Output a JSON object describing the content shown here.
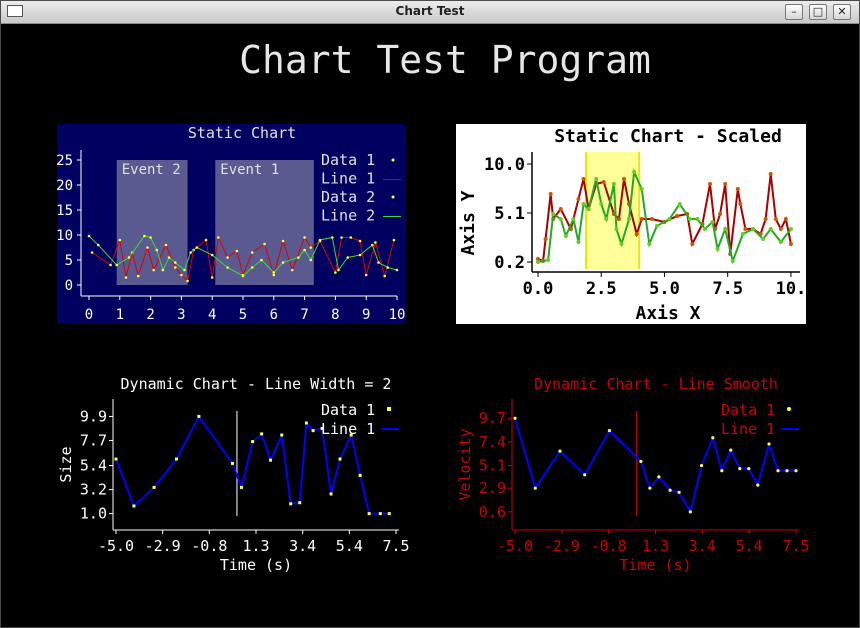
{
  "window": {
    "title": "Chart Test"
  },
  "app_title": "Chart Test Program",
  "chart_data": [
    {
      "type": "line",
      "title": "Static Chart",
      "xlim": [
        0,
        10
      ],
      "ylim": [
        0,
        27
      ],
      "x_ticks": [
        "0",
        "1",
        "2",
        "3",
        "4",
        "5",
        "6",
        "7",
        "8",
        "9",
        "10"
      ],
      "y_ticks": [
        "0",
        "5",
        "10",
        "15",
        "20",
        "25"
      ],
      "legend_position": "top-right",
      "events": [
        {
          "name": "Event 2",
          "x_start": 0.9,
          "x_end": 3.2
        },
        {
          "name": "Event 1",
          "x_start": 4.1,
          "x_end": 7.3
        }
      ],
      "series": [
        {
          "name": "Data 1",
          "color": "#ffff44",
          "x": [
            0.1,
            0.7,
            1.0,
            1.2,
            1.4,
            1.6,
            1.9,
            2.1,
            2.5,
            2.8,
            3.0,
            3.2,
            3.4,
            3.8,
            4.0,
            4.2,
            4.5,
            4.8,
            5.0,
            5.3,
            5.7,
            6.0,
            6.3,
            6.6,
            7.0,
            7.2,
            7.5,
            8.0,
            8.2,
            8.5,
            8.8,
            9.0,
            9.3,
            9.6,
            9.9
          ],
          "y": [
            6.5,
            4.0,
            9.0,
            1.5,
            6.5,
            1.8,
            7.5,
            3.0,
            8.0,
            3.5,
            2.0,
            0.8,
            7.0,
            9.0,
            1.5,
            9.5,
            5.5,
            6.8,
            2.0,
            6.5,
            8.2,
            2.0,
            8.8,
            3.0,
            9.5,
            7.5,
            8.8,
            2.5,
            9.5,
            9.5,
            8.8,
            2.0,
            8.5,
            1.8,
            9.0
          ]
        },
        {
          "name": "Data 2",
          "color": "#ffff44",
          "x": [
            0.0,
            0.3,
            0.9,
            1.3,
            1.8,
            2.0,
            2.2,
            2.4,
            2.6,
            2.8,
            3.1,
            3.3,
            3.5,
            4.0,
            4.5,
            5.0,
            5.3,
            5.6,
            6.0,
            6.3,
            6.8,
            7.0,
            7.2,
            7.5,
            7.9,
            8.1,
            8.4,
            8.8,
            9.2,
            9.4,
            9.7,
            10.0
          ],
          "y": [
            9.8,
            8.0,
            4.0,
            5.5,
            9.8,
            9.5,
            7.0,
            3.0,
            5.5,
            4.5,
            3.0,
            6.5,
            7.5,
            6.0,
            3.5,
            1.8,
            3.5,
            5.0,
            2.5,
            4.5,
            5.5,
            7.0,
            5.0,
            9.0,
            9.5,
            3.0,
            5.5,
            6.0,
            8.0,
            4.5,
            3.5,
            3.0
          ]
        }
      ]
    },
    {
      "type": "line",
      "title": "Static Chart - Scaled",
      "xlabel": "Axis X",
      "ylabel": "Axis Y",
      "xlim": [
        0,
        10.2
      ],
      "ylim": [
        -0.5,
        11.2
      ],
      "x_ticks": [
        {
          "value": 0.0,
          "label": "0.0"
        },
        {
          "value": 2.5,
          "label": "2.5"
        },
        {
          "value": 5.0,
          "label": "5.0"
        },
        {
          "value": 7.5,
          "label": "7.5"
        },
        {
          "value": 10.0,
          "label": "10."
        }
      ],
      "y_ticks": [
        {
          "value": 10.0,
          "label": "10.0"
        },
        {
          "value": 5.1,
          "label": "5.1"
        },
        {
          "value": 0.2,
          "label": "0.2"
        }
      ],
      "highlight": {
        "x_start": 1.9,
        "x_end": 4.0,
        "color": "#ffff99"
      },
      "series": [
        {
          "name": "red",
          "color": "#aa0000",
          "x": [
            0.0,
            0.2,
            0.3,
            0.5,
            0.6,
            0.9,
            1.3,
            1.6,
            1.8,
            2.0,
            2.3,
            2.6,
            3.0,
            3.2,
            3.4,
            3.6,
            3.9,
            4.1,
            4.5,
            5.0,
            5.5,
            5.9,
            6.1,
            6.5,
            6.8,
            7.0,
            7.2,
            7.4,
            7.6,
            7.9,
            8.0,
            8.2,
            8.5,
            8.8,
            9.0,
            9.2,
            9.4,
            9.6,
            9.8,
            10.0
          ],
          "y": [
            0.5,
            0.3,
            2.5,
            7.0,
            4.5,
            5.5,
            3.5,
            6.5,
            8.5,
            5.5,
            8.0,
            8.2,
            5.0,
            4.5,
            8.5,
            6.0,
            3.0,
            4.5,
            4.5,
            4.2,
            4.8,
            5.0,
            2.0,
            4.0,
            8.0,
            3.5,
            5.0,
            8.0,
            1.0,
            7.5,
            6.0,
            3.5,
            3.5,
            3.0,
            4.5,
            9.0,
            4.5,
            3.5,
            4.5,
            2.0
          ]
        },
        {
          "name": "green",
          "color": "#22aa22",
          "x": [
            0.0,
            0.4,
            0.6,
            0.9,
            1.1,
            1.4,
            1.6,
            1.8,
            2.0,
            2.3,
            2.5,
            2.7,
            3.0,
            3.1,
            3.3,
            3.6,
            3.8,
            4.1,
            4.4,
            4.7,
            5.2,
            5.6,
            6.0,
            6.3,
            6.6,
            6.9,
            7.1,
            7.4,
            7.7,
            8.1,
            8.5,
            8.9,
            9.2,
            9.6,
            10.0
          ],
          "y": [
            0.2,
            0.4,
            5.0,
            4.5,
            2.8,
            4.5,
            2.2,
            6.0,
            5.5,
            8.5,
            6.0,
            4.5,
            8.0,
            3.5,
            2.0,
            4.5,
            9.2,
            7.5,
            2.0,
            3.8,
            4.5,
            6.0,
            4.5,
            4.5,
            3.5,
            4.2,
            1.5,
            3.5,
            0.3,
            3.0,
            3.5,
            2.5,
            3.5,
            2.2,
            3.5
          ]
        }
      ]
    },
    {
      "type": "line",
      "title": "Dynamic Chart - Line Width = 2",
      "xlabel": "Time (s)",
      "ylabel": "Size",
      "xlim": [
        -5.0,
        7.5
      ],
      "ylim": [
        0.6,
        10.3
      ],
      "x_ticks": [
        "-5.0",
        "-2.9",
        "-0.8",
        "1.3",
        "3.4",
        "5.4",
        "7.5"
      ],
      "y_ticks": [
        "1.0",
        "3.2",
        "5.4",
        "7.7",
        "9.9"
      ],
      "marker_x": 0.4,
      "legend_position": "top-right",
      "series": [
        {
          "name": "Data 1",
          "color": "#ffff44"
        },
        {
          "name": "Line 1",
          "color": "#0000ff",
          "x": [
            -5.0,
            -4.2,
            -3.3,
            -2.3,
            -1.3,
            0.2,
            0.6,
            1.1,
            1.5,
            1.9,
            2.4,
            2.8,
            3.2,
            3.5,
            3.8,
            4.2,
            4.6,
            5.0,
            5.5,
            5.9,
            6.3,
            6.8,
            7.2
          ],
          "y": [
            6.0,
            1.7,
            3.4,
            6.0,
            9.9,
            5.6,
            3.4,
            7.6,
            8.3,
            5.9,
            8.2,
            1.9,
            2.0,
            9.3,
            8.6,
            8.8,
            2.8,
            6.0,
            8.2,
            4.5,
            1.0,
            1.0,
            1.0
          ]
        }
      ]
    },
    {
      "type": "line",
      "title": "Dynamic Chart - Line Smooth",
      "xlabel": "Time (s)",
      "ylabel": "Velocity",
      "xlim": [
        -5.0,
        7.5
      ],
      "ylim": [
        0.0,
        10.3
      ],
      "x_ticks": [
        "-5.0",
        "-2.9",
        "-0.8",
        "1.3",
        "3.4",
        "5.4",
        "7.5"
      ],
      "y_ticks": [
        "0.6",
        "2.9",
        "5.1",
        "7.4",
        "9.7"
      ],
      "marker_x": 0.4,
      "legend_position": "top-right",
      "series": [
        {
          "name": "Data 1",
          "color": "#ffff44"
        },
        {
          "name": "Line 1",
          "color": "#0000ff",
          "x": [
            -5.0,
            -4.1,
            -3.0,
            -1.9,
            -0.8,
            0.6,
            1.0,
            1.4,
            1.9,
            2.3,
            2.8,
            3.3,
            3.8,
            4.2,
            4.6,
            5.0,
            5.4,
            5.8,
            6.3,
            6.7,
            7.1,
            7.5
          ],
          "y": [
            9.7,
            2.9,
            6.5,
            4.2,
            8.5,
            5.5,
            2.9,
            4.0,
            2.7,
            2.5,
            0.6,
            5.1,
            7.8,
            4.6,
            6.6,
            4.8,
            4.8,
            3.2,
            7.2,
            4.6,
            4.6,
            4.6
          ]
        }
      ]
    }
  ]
}
